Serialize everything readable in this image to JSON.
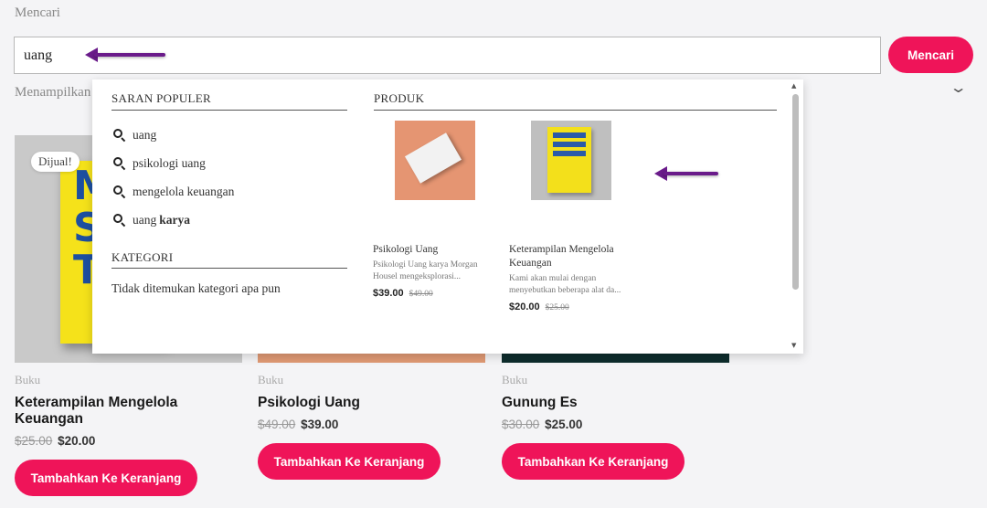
{
  "search": {
    "label": "Mencari",
    "value": "uang",
    "button_label": "Mencari"
  },
  "results": {
    "count_text": "Menampilkan",
    "sort_icon": "chevron-down-icon"
  },
  "products": [
    {
      "category": "Buku",
      "title": "Keterampilan Mengelola Keuangan",
      "old_price": "$25.00",
      "price": "$20.00",
      "cart_label": "Tambahkan Ke Keranjang",
      "badge": "Dijual!",
      "cover_text": [
        "M",
        "S",
        "T"
      ]
    },
    {
      "category": "Buku",
      "title": "Psikologi Uang",
      "old_price": "$49.00",
      "price": "$39.00",
      "cart_label": "Tambahkan Ke Keranjang"
    },
    {
      "category": "Buku",
      "title": "Gunung Es",
      "old_price": "$30.00",
      "price": "$25.00",
      "cart_label": "Tambahkan Ke Keranjang"
    }
  ],
  "dropdown": {
    "suggestions_heading": "SARAN POPULER",
    "suggestions": [
      {
        "text": "uang",
        "bold": ""
      },
      {
        "text": "psikologi uang",
        "bold": ""
      },
      {
        "text": "mengelola keuangan",
        "bold": ""
      },
      {
        "text": "uang",
        "bold": "karya"
      }
    ],
    "category_heading": "KATEGORI",
    "category_empty": "Tidak ditemukan kategori apa pun",
    "products_heading": "PRODUK",
    "products": [
      {
        "title": "Psikologi Uang",
        "desc": "Psikologi Uang karya Morgan Housel mengeksplorasi...",
        "price": "$39.00",
        "old_price": "$49.00"
      },
      {
        "title": "Keterampilan Mengelola Keuangan",
        "desc": "Kami akan mulai dengan menyebutkan beberapa alat da...",
        "price": "$20.00",
        "old_price": "$25.00"
      }
    ]
  },
  "colors": {
    "accent": "#ef1459",
    "annotation_arrow": "#6a1b8a"
  }
}
